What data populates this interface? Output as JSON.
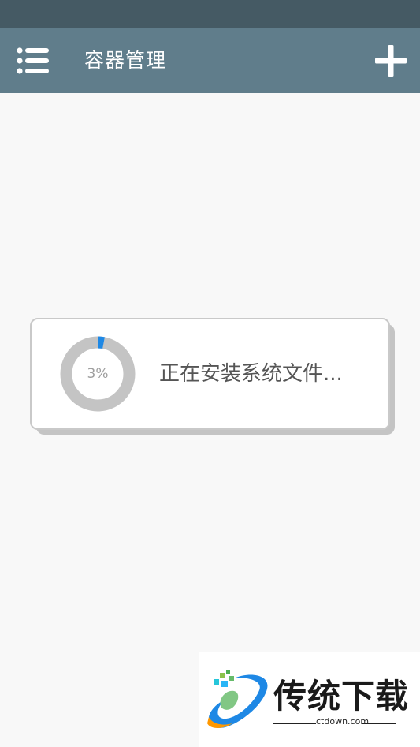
{
  "app_bar": {
    "title": "容器管理",
    "menu_icon": "list-menu-icon",
    "add_icon": "plus-icon"
  },
  "dialog": {
    "progress_percent": 3,
    "progress_label": "3%",
    "message": "正在安装系统文件..."
  },
  "watermark": {
    "title": "传统下载",
    "domain": "ctdown.com"
  },
  "colors": {
    "status_bar": "#455a64",
    "app_bar": "#607d8b",
    "progress_track": "#c4c4c4",
    "progress_fill": "#1e88e5"
  }
}
